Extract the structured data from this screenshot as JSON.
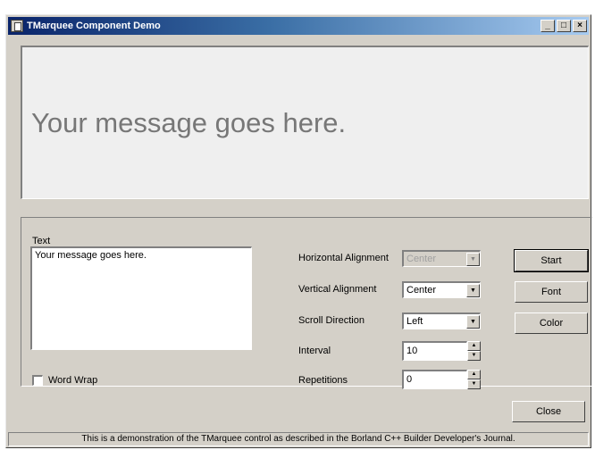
{
  "window": {
    "title": "TMarquee Component Demo",
    "minimize_glyph": "_",
    "maximize_glyph": "□",
    "close_glyph": "×"
  },
  "marquee": {
    "message": "Your message goes here."
  },
  "text_section": {
    "label": "Text",
    "value": "Your message goes here.",
    "word_wrap_label": "Word Wrap",
    "word_wrap_checked": false
  },
  "settings": {
    "horizontal_alignment": {
      "label": "Horizontal Alignment",
      "value": "Center",
      "enabled": false
    },
    "vertical_alignment": {
      "label": "Vertical Alignment",
      "value": "Center"
    },
    "scroll_direction": {
      "label": "Scroll Direction",
      "value": "Left"
    },
    "interval": {
      "label": "Interval",
      "value": "10"
    },
    "repetitions": {
      "label": "Repetitions",
      "value": "0"
    }
  },
  "buttons": {
    "start": "Start",
    "font": "Font",
    "color": "Color",
    "close": "Close"
  },
  "status": {
    "text": "This is a demonstration of the TMarquee control as described in the Borland C++ Builder Developer's Journal."
  },
  "icons": {
    "dropdown": "▼",
    "spin_up": "▲",
    "spin_down": "▼"
  }
}
